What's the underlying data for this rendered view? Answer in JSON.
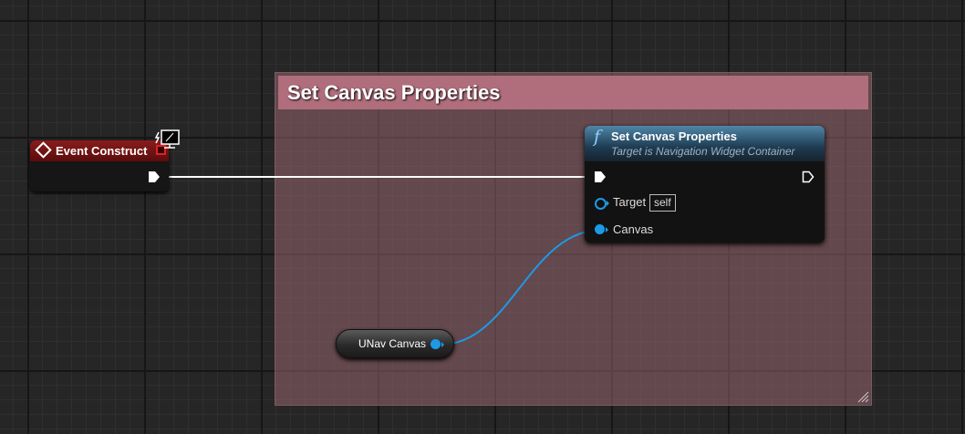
{
  "comment": {
    "title": "Set Canvas Properties"
  },
  "event_node": {
    "title": "Event Construct"
  },
  "function_node": {
    "title": "Set Canvas Properties",
    "subtitle": "Target is Navigation Widget Container",
    "pins": {
      "target_label": "Target",
      "target_default": "self",
      "canvas_label": "Canvas"
    }
  },
  "variable_node": {
    "label": "UNav Canvas"
  },
  "colors": {
    "object_pin": "#1c9ae8",
    "event_header": "#8a1c1c",
    "comment_header": "#b06e7c"
  }
}
